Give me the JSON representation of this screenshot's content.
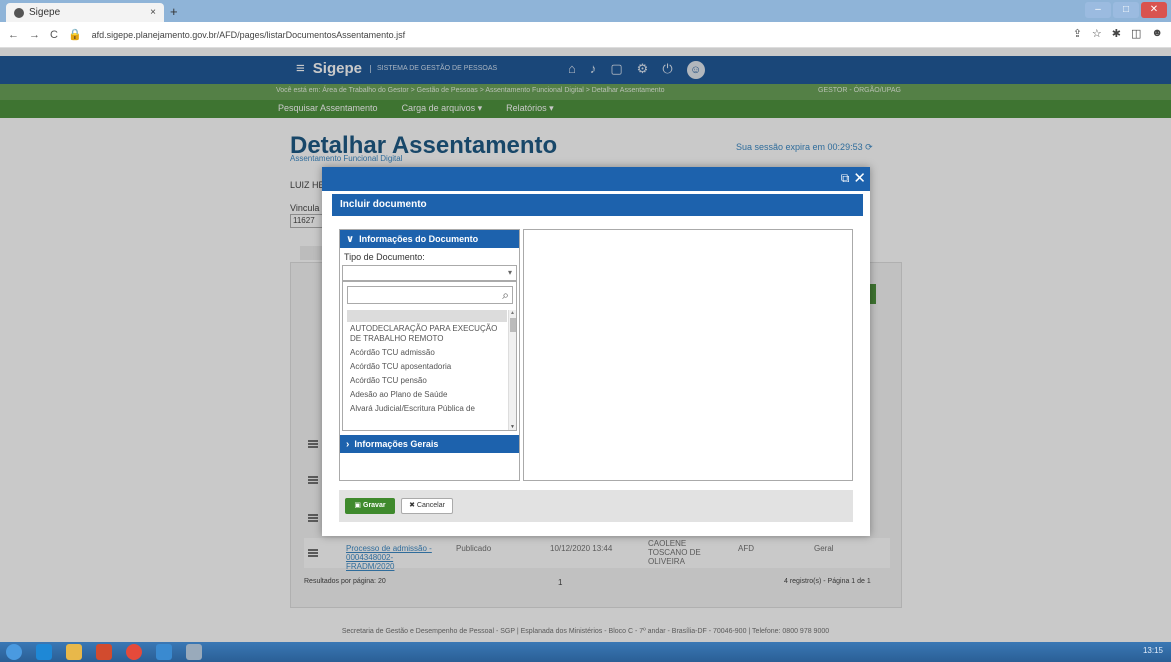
{
  "browser": {
    "tab_title": "Sigepe",
    "tab_close": "×",
    "new_tab": "+",
    "url": "afd.sigepe.planejamento.gov.br/AFD/pages/listarDocumentosAssentamento.jsf",
    "nav_back": "←",
    "nav_forward": "→",
    "nav_reload": "C"
  },
  "app": {
    "brand": "Sigepe",
    "brand_sub": "SISTEMA DE GESTÃO DE PESSOAS",
    "breadcrumb": "Você está em: Área de Trabalho do Gestor > Gestão de Pessoas > Assentamento Funcional Digital > Detalhar Assentamento",
    "role": "GESTOR - ÓRGÃO/UPAG",
    "menu": [
      "Pesquisar Assentamento",
      "Carga de arquivos",
      "Relatórios"
    ]
  },
  "page": {
    "title": "Detalhar Assentamento",
    "subtitle": "Assentamento Funcional Digital",
    "session": "Sua sessão expira em 00:29:53",
    "field_name": "LUIZ HE",
    "field_vinculo": "Vincula",
    "field_vinculo_value": "11627",
    "row": {
      "doc": "Processo de admissão - 0004348002-FRADM/2020",
      "status": "Publicado",
      "date": "10/12/2020 13:44",
      "user": "CAOLENE TOSCANO DE OLIVEIRA",
      "origin": "AFD",
      "scope": "Geral"
    },
    "pager_left": "Resultados por página: 20",
    "pager_center": "1",
    "pager_right": "4 registro(s) - Página 1 de 1",
    "footer": "Secretaria de Gestão e Desempenho de Pessoal - SGP | Esplanada dos Ministérios - Bloco C - 7º andar - Brasília-DF - 70046-900 | Telefone: 0800 978 9000"
  },
  "modal": {
    "title": "Incluir documento",
    "section_doc": "Informações do Documento",
    "label_tipo": "Tipo de Documento:",
    "search_placeholder": "",
    "options": [
      "AUTODECLARAÇÃO PARA EXECUÇÃO DE TRABALHO REMOTO",
      "Acórdão TCU admissão",
      "Acórdão TCU aposentadoria",
      "Acórdão TCU pensão",
      "Adesão ao Plano de Saúde",
      "Alvará Judicial/Escritura Pública de"
    ],
    "section_gerais": "Informações Gerais",
    "save": "Gravar",
    "cancel": "Cancelar"
  },
  "taskbar": {
    "clock": "13:15"
  }
}
